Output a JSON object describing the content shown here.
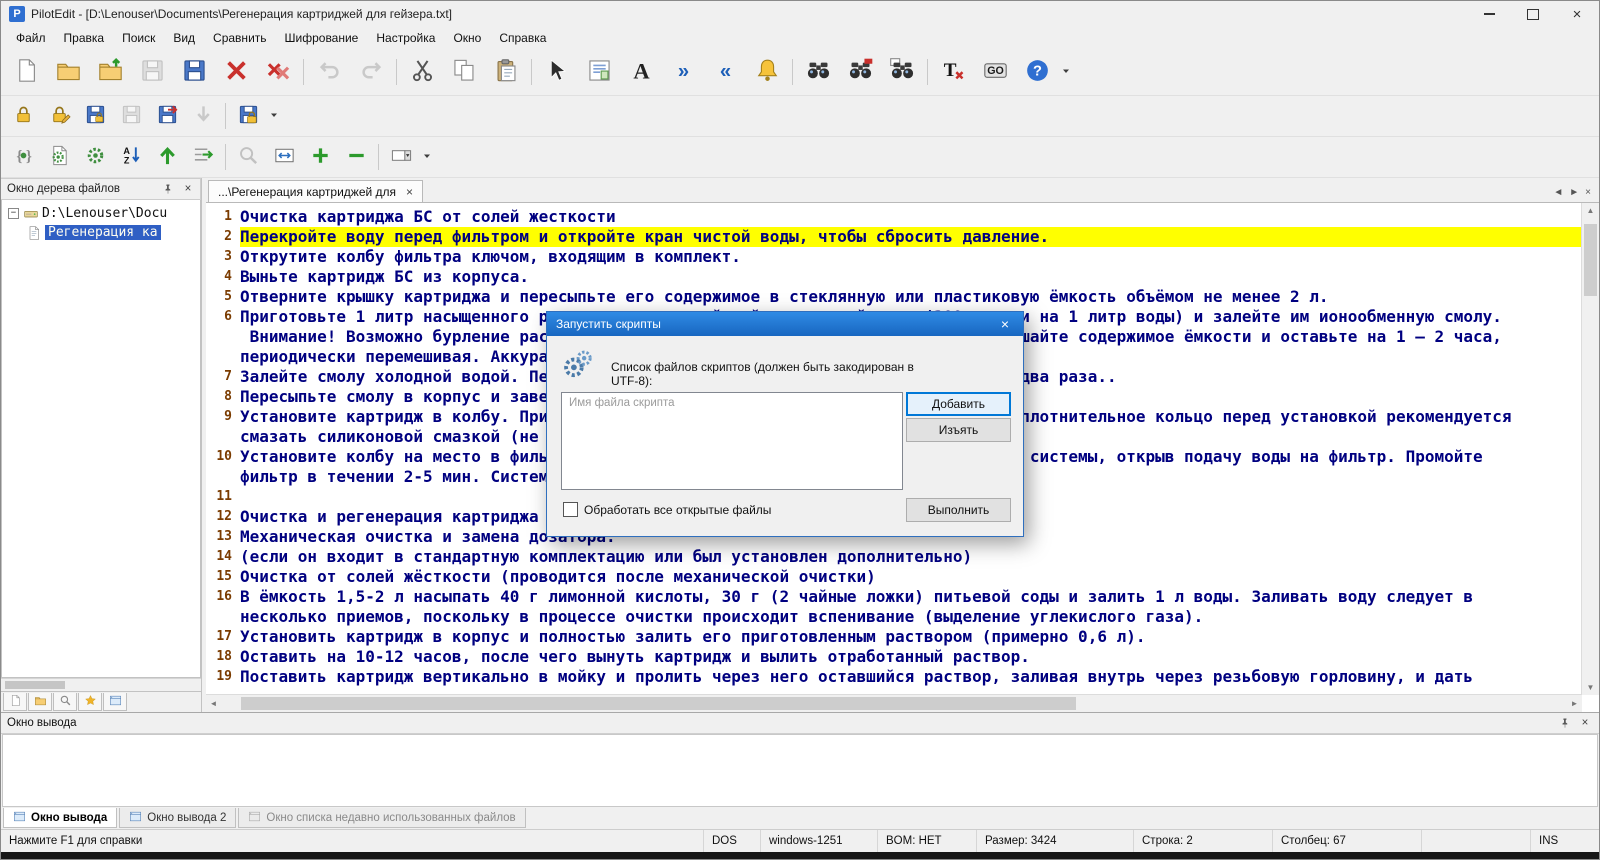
{
  "window": {
    "title": "PilotEdit - [D:\\Lenouser\\Documents\\Регенерация картриджей для гейзера.txt]"
  },
  "glyphs": {
    "close": "×",
    "caret": "▾",
    "nav_left": "◄",
    "nav_right": "►",
    "scroll_up": "▲",
    "scroll_down": "▼",
    "scroll_left": "◄",
    "scroll_right": "►",
    "expander_open": "−",
    "app_letter": "P"
  },
  "menu": [
    {
      "key": "file",
      "label": "Файл"
    },
    {
      "key": "edit",
      "label": "Правка"
    },
    {
      "key": "search",
      "label": "Поиск"
    },
    {
      "key": "view",
      "label": "Вид"
    },
    {
      "key": "compare",
      "label": "Сравнить"
    },
    {
      "key": "encryption",
      "label": "Шифрование"
    },
    {
      "key": "settings",
      "label": "Настройка"
    },
    {
      "key": "window",
      "label": "Окно"
    },
    {
      "key": "help",
      "label": "Справка"
    }
  ],
  "toolbars": {
    "row1": [
      {
        "icon": "new-file"
      },
      {
        "icon": "open-folder"
      },
      {
        "icon": "folder-up"
      },
      {
        "icon": "save",
        "disabled": true
      },
      {
        "icon": "save-all"
      },
      {
        "icon": "close-file"
      },
      {
        "icon": "close-all"
      },
      {
        "sep": true
      },
      {
        "icon": "undo",
        "disabled": true
      },
      {
        "icon": "redo",
        "disabled": true
      },
      {
        "sep": true
      },
      {
        "icon": "cut"
      },
      {
        "icon": "copy"
      },
      {
        "icon": "paste"
      },
      {
        "sep": true
      },
      {
        "icon": "select-arrow"
      },
      {
        "icon": "column-edit"
      },
      {
        "icon": "font"
      },
      {
        "icon": "angles-right"
      },
      {
        "icon": "angles-left"
      },
      {
        "icon": "bell"
      },
      {
        "sep": true
      },
      {
        "icon": "find"
      },
      {
        "icon": "find-next"
      },
      {
        "icon": "find-in-files"
      },
      {
        "sep": true
      },
      {
        "icon": "replace-text"
      },
      {
        "icon": "goto"
      },
      {
        "icon": "help"
      },
      {
        "icon": "caret"
      }
    ],
    "row2": [
      {
        "icon": "lock"
      },
      {
        "icon": "lock-edit"
      },
      {
        "icon": "save-lock"
      },
      {
        "icon": "save",
        "disabled": true
      },
      {
        "icon": "save-export"
      },
      {
        "icon": "arrow-down",
        "disabled": true
      },
      {
        "sep": true
      },
      {
        "icon": "save-lock-big"
      },
      {
        "icon": "caret"
      }
    ],
    "row3": [
      {
        "icon": "script-braces"
      },
      {
        "icon": "page-gear"
      },
      {
        "icon": "gear-green"
      },
      {
        "icon": "sort-az"
      },
      {
        "icon": "up-green"
      },
      {
        "icon": "wrap-green"
      },
      {
        "sep": true
      },
      {
        "icon": "zoom",
        "disabled": true
      },
      {
        "icon": "fit-width"
      },
      {
        "icon": "plus-green"
      },
      {
        "icon": "minus-green"
      },
      {
        "sep": true
      },
      {
        "icon": "combo"
      },
      {
        "icon": "caret"
      }
    ]
  },
  "tree_panel": {
    "title": "Окно дерева файлов",
    "items": [
      {
        "label": "D:\\Lenouser\\Docu",
        "level": 0,
        "icon": "drive",
        "expanded": true
      },
      {
        "label": "Регенерация ка",
        "level": 1,
        "icon": "file-page",
        "selected": true
      }
    ],
    "mini_tabs": [
      {
        "key": "files",
        "icon": "mini-page"
      },
      {
        "key": "folders",
        "icon": "open-folder"
      },
      {
        "key": "search",
        "icon": "zoom"
      },
      {
        "key": "favorites",
        "icon": "star"
      },
      {
        "key": "recent",
        "icon": "win"
      }
    ]
  },
  "editor": {
    "tab_label": "...\\Регенерация картриджей для",
    "lines": [
      {
        "n": "1",
        "t": "Очистка картриджа БС от солей жесткости"
      },
      {
        "n": "2",
        "t": "Перекройте воду перед фильтром и откройте кран чистой воды, чтобы сбросить давление.",
        "hl": true
      },
      {
        "n": "3",
        "t": "Открутите колбу фильтра ключом, входящим в комплект."
      },
      {
        "n": "4",
        "t": "Выньте картридж БС из корпуса."
      },
      {
        "n": "5",
        "t": "Отверните крышку картриджа и пересыпьте его содержимое в стеклянную или пластиковую ёмкость объёмом не менее 2 л."
      },
      {
        "n": "6",
        "t": "Приготовьте 1 литр насыщенного раствора поваренной нейодированной соли (300 г соли на 1 литр воды) и залейте им ионообменную смолу."
      },
      {
        "n": "",
        "t": " Внимание! Возможно бурление раствора и сильное выделение тепла. Тщательно перемешайте содержимое ёмкости и оставьте на 1 – 2 часа,"
      },
      {
        "n": "",
        "t": "периодически перемешивая. Аккуратно слейте отработанный раствор."
      },
      {
        "n": "7",
        "t": "Залейте смолу холодной водой. Перемешайте смолу и слейте воду. Повторите всё это два раза.."
      },
      {
        "n": "8",
        "t": "Пересыпьте смолу в корпус и заверните крышку картриджа."
      },
      {
        "n": "9",
        "t": "Установите картридж в колбу. Присоединении колбы обратите внимание на резьбу, а уплотнительное кольцо перед установкой рекомендуется"
      },
      {
        "n": "",
        "t": "смазать силиконовой смазкой (не солидолом)."
      },
      {
        "n": "10",
        "t": "Установите колбу на место в фильтр и заверните её ключом. Проверьте герметичность системы, открыв подачу воды на фильтр. Промойте"
      },
      {
        "n": "",
        "t": "фильтр в течении 2-5 мин. Система готова к работе."
      },
      {
        "n": "11",
        "t": ""
      },
      {
        "n": "12",
        "t": "Очистка и регенерация картриджа БС"
      },
      {
        "n": "13",
        "t": "Механическая очистка и замена дозатора."
      },
      {
        "n": "14",
        "t": "(если он входит в стандартную комплектацию или был установлен дополнительно)"
      },
      {
        "n": "15",
        "t": "Очистка от солей жёсткости (проводится после механической очистки)"
      },
      {
        "n": "16",
        "t": "В ёмкость 1,5-2 л насыпать 40 г лимонной кислоты, 30 г (2 чайные ложки) питьевой соды и залить 1 л воды. Заливать воду следует в"
      },
      {
        "n": "",
        "t": "несколько приемов, поскольку в процессе очистки происходит вспенивание (выделение углекислого газа)."
      },
      {
        "n": "17",
        "t": "Установить картридж в корпус и полностью залить его приготовленным раствором (примерно 0,6 л)."
      },
      {
        "n": "18",
        "t": "Оставить на 10-12 часов, после чего вынуть картридж и вылить отработанный раствор."
      },
      {
        "n": "19",
        "t": "Поставить картридж вертикально в мойку и пролить через него оставшийся раствор, заливая внутрь через резьбовую горловину, и дать"
      }
    ]
  },
  "dialog": {
    "title": "Запустить скрипты",
    "label": "Список файлов скриптов (должен быть закодирован в UTF-8):",
    "list_header": "Имя файла скрипта",
    "buttons": {
      "add": "Добавить",
      "remove": "Изъять",
      "run": "Выполнить"
    },
    "checkbox_label": "Обработать все открытые файлы",
    "checkbox_checked": false
  },
  "output": {
    "title": "Окно вывода",
    "tabs": [
      {
        "key": "output1",
        "label": "Окно вывода",
        "active": true
      },
      {
        "key": "output2",
        "label": "Окно вывода 2"
      },
      {
        "key": "recent-files",
        "label": "Окно списка недавно использованных файлов",
        "dim": true
      }
    ]
  },
  "status": {
    "help": "Нажмите F1 для справки",
    "segments": [
      {
        "key": "dos",
        "label": "DOS"
      },
      {
        "key": "encoding",
        "label": "windows-1251"
      },
      {
        "key": "bom",
        "label": "BOM: НЕТ"
      },
      {
        "key": "size",
        "label": "Размер: 3424"
      },
      {
        "key": "line",
        "label": "Строка: 2"
      },
      {
        "key": "column",
        "label": "Столбец: 67"
      },
      {
        "key": "spare",
        "label": ""
      },
      {
        "key": "ins",
        "label": "INS"
      }
    ]
  }
}
